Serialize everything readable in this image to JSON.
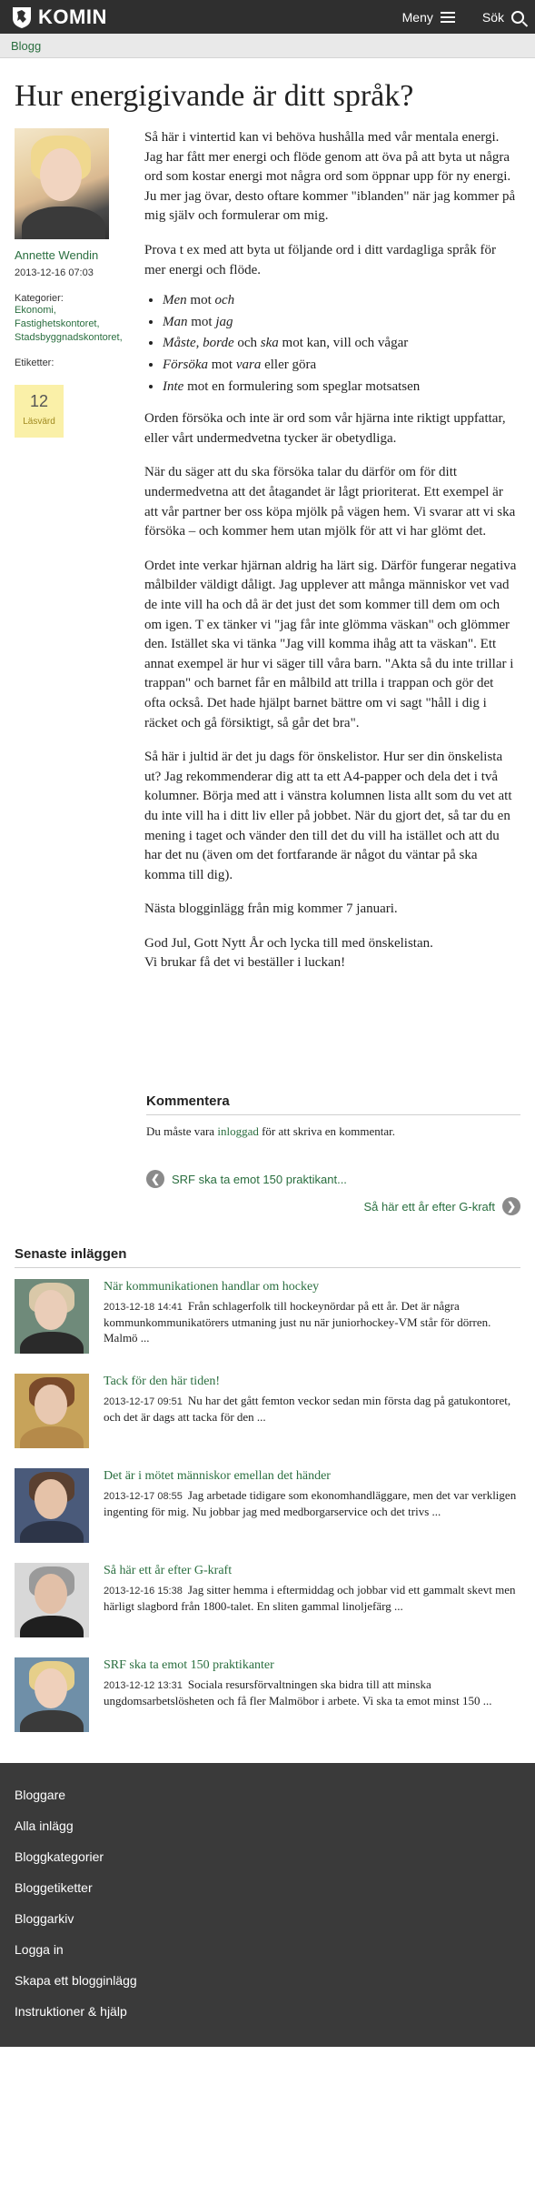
{
  "header": {
    "logo_text": "KOMIN",
    "menu_label": "Meny",
    "search_label": "Sök"
  },
  "breadcrumb": "Blogg",
  "post": {
    "title": "Hur energigivande är ditt språk?",
    "author": "Annette Wendin",
    "date": "2013-12-16 07:03",
    "categories_label": "Kategorier:",
    "categories": [
      "Ekonomi,",
      "Fastighetskontoret,",
      "Stadsbyggnadskontoret,"
    ],
    "tags_label": "Etiketter:",
    "read_count": "12",
    "read_label": "Läsvärd",
    "paragraphs": [
      "Så här i vintertid kan vi behöva hushålla med vår mentala energi. Jag har fått mer energi och flöde genom att öva på att byta ut några ord som kostar energi mot några ord som öppnar upp för ny energi. Ju mer jag övar, desto oftare kommer \"iblanden\" när jag kommer på mig själv och formulerar om mig.",
      "Prova t ex med att byta ut följande ord i ditt vardagliga språk för mer energi och flöde."
    ],
    "list": [
      {
        "a": "Men",
        "mid": " mot ",
        "b": "och",
        "rest": ""
      },
      {
        "a": "Man",
        "mid": " mot ",
        "b": "jag",
        "rest": ""
      },
      {
        "a": "Måste, borde",
        "mid": " och ",
        "b": "ska",
        "rest": " mot kan, vill och vågar"
      },
      {
        "a": "Försöka",
        "mid": " mot ",
        "b": "vara",
        "rest": " eller göra"
      },
      {
        "a": "Inte",
        "mid": " mot en formulering som speglar motsatsen",
        "b": "",
        "rest": ""
      }
    ],
    "paragraphs2": [
      "Orden försöka och inte är ord som vår hjärna inte riktigt uppfattar, eller vårt undermedvetna tycker är obetydliga.",
      "När du säger att du ska försöka talar du därför om för ditt undermedvetna att det åtagandet är lågt prioriterat. Ett exempel är att vår partner ber oss köpa mjölk på vägen hem. Vi svarar att vi ska försöka – och kommer hem utan mjölk för att vi har glömt det.",
      "Ordet inte verkar hjärnan aldrig ha lärt sig. Därför fungerar negativa målbilder väldigt dåligt. Jag upplever att många människor vet vad de inte vill ha och då är det just det som kommer till dem om och om igen. T ex tänker vi \"jag får inte glömma väskan\" och glömmer den. Istället ska vi tänka \"Jag vill komma ihåg att ta väskan\". Ett annat exempel är hur vi säger till våra barn. \"Akta så du inte trillar i trappan\" och barnet får en målbild att trilla i trappan och gör det ofta också. Det hade hjälpt barnet bättre om vi sagt \"håll i dig i räcket och gå försiktigt, så går det bra\".",
      "Så här i jultid är det ju dags för önskelistor. Hur ser din önskelista ut? Jag rekommenderar dig att ta ett A4-papper och dela det i två kolumner. Börja med att i vänstra kolumnen lista allt som du vet att du inte vill ha i ditt liv eller på jobbet. När du gjort det, så tar du en mening i taget och vänder den till det du vill ha istället och att du har det nu (även om det fortfarande är något du väntar på ska komma till dig).",
      "Nästa blogginlägg  från mig kommer 7 januari."
    ],
    "signoff_1": "God Jul, Gott Nytt År och lycka till med önskelistan.",
    "signoff_2": "Vi brukar få det vi beställer i luckan!"
  },
  "comments": {
    "title": "Kommentera",
    "note_pre": "Du måste vara ",
    "note_link": "inloggad",
    "note_post": " för att skriva en kommentar."
  },
  "pager": {
    "prev": "SRF ska ta emot 150 praktikant...",
    "next": "Så här ett år efter G-kraft"
  },
  "latest": {
    "title": "Senaste inläggen",
    "items": [
      {
        "title": "När kommunikationen handlar om hockey",
        "date": "2013-12-18 14:41",
        "excerpt": "Från schlagerfolk till hockeynördar på ett år. Det är några kommunkommunikatörers utmaning just nu när juniorhockey-VM står för dörren. Malmö ..."
      },
      {
        "title": "Tack för den här tiden!",
        "date": "2013-12-17 09:51",
        "excerpt": "Nu har det gått femton veckor sedan min första dag på gatukontoret, och det är dags att tacka för den ..."
      },
      {
        "title": "Det är i mötet människor emellan det händer",
        "date": "2013-12-17 08:55",
        "excerpt": "Jag arbetade tidigare som ekonomhandläggare, men det var verkligen ingenting för mig. Nu jobbar jag med medborgarservice och det trivs ..."
      },
      {
        "title": "Så här ett år efter G-kraft",
        "date": "2013-12-16 15:38",
        "excerpt": "Jag sitter hemma i eftermiddag och jobbar vid ett gammalt skevt men härligt slagbord från 1800-talet. En sliten gammal linoljefärg ..."
      },
      {
        "title": "SRF ska ta emot 150 praktikanter",
        "date": "2013-12-12 13:31",
        "excerpt": "Sociala resursförvaltningen ska bidra till att minska ungdomsarbetslösheten och få fler Malmöbor i arbete. Vi ska ta emot minst 150 ..."
      }
    ]
  },
  "footer": {
    "links": [
      "Bloggare",
      "Alla inlägg",
      "Bloggkategorier",
      "Bloggetiketter",
      "Bloggarkiv",
      "Logga in",
      "Skapa ett blogginlägg",
      "Instruktioner & hjälp"
    ]
  },
  "colors": {
    "topbar": "#2f2f2f",
    "link_green": "#2a6e3f",
    "footer": "#3a3a3a",
    "readcount_bg": "#faf0a8"
  }
}
